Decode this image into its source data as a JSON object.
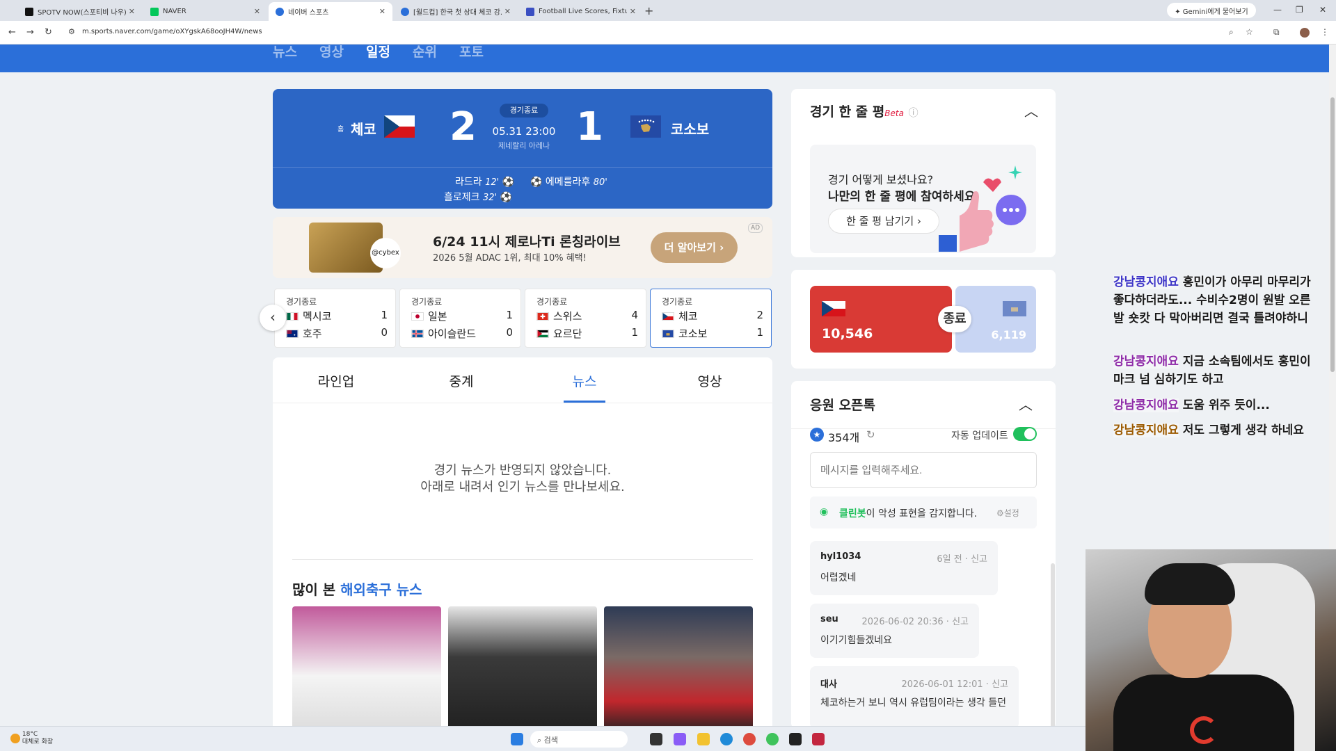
{
  "browser": {
    "tabs": [
      {
        "label": "SPOTV NOW(스포티비 나우)"
      },
      {
        "label": "NAVER"
      },
      {
        "label": "네이버 스포츠"
      },
      {
        "label": "[월드컵] 한국 첫 상대 체코 강..."
      },
      {
        "label": "Football Live Scores, Fixtures &..."
      }
    ],
    "gemini": "✦ Gemini에게 물어보기",
    "url": "m.sports.naver.com/game/oXYgskA68ooJH4W/news"
  },
  "nav": {
    "items": [
      "뉴스",
      "영상",
      "일정",
      "순위",
      "포토"
    ],
    "active": "일정"
  },
  "match": {
    "home_badge": "홈",
    "home": "체코",
    "away": "코소보",
    "home_score": "2",
    "away_score": "1",
    "status": "경기종료",
    "date": "05.31 23:00",
    "venue": "제네랄리 아레나",
    "goals_home": [
      {
        "player": "라드라",
        "minute": "12'"
      },
      {
        "player": "흘로제크",
        "minute": "32'"
      }
    ],
    "goals_away": [
      {
        "player": "에메를라후",
        "minute": "80'"
      }
    ],
    "colors": {
      "scoreboard": "#2c66c5",
      "accent": "#2b6fd9"
    }
  },
  "ad": {
    "title": "6/24 11시 제로나Ti 론칭라이브",
    "subtitle": "2026 5월 ADAC 1위, 최대 10% 혜택!",
    "button": "더 알아보기 ›",
    "tag": "AD",
    "logo": "@cybex"
  },
  "other_matches": [
    {
      "status": "경기종료",
      "home": "멕시코",
      "home_score": "1",
      "away": "호주",
      "away_score": "0"
    },
    {
      "status": "경기종료",
      "home": "일본",
      "home_score": "1",
      "away": "아이슬란드",
      "away_score": "0"
    },
    {
      "status": "경기종료",
      "home": "스위스",
      "home_score": "4",
      "away": "요르단",
      "away_score": "1"
    },
    {
      "status": "경기종료",
      "home": "체코",
      "home_score": "2",
      "away": "코소보",
      "away_score": "1"
    }
  ],
  "content_tabs": [
    "라인업",
    "중계",
    "뉴스",
    "영상"
  ],
  "content_active": "뉴스",
  "news_empty": {
    "line1": "경기 뉴스가 반영되지 않았습니다.",
    "line2": "아래로 내려서 인기 뉴스를 만나보세요."
  },
  "popular": {
    "prefix": "많이 본",
    "highlight": "해외축구 뉴스"
  },
  "one_line": {
    "title": "경기 한 줄 평",
    "beta": "Beta",
    "question": "경기 어떻게 보셨나요?",
    "invite": "나만의 한 줄 평에 참여하세요.",
    "button": "한 줄 평 남기기 ›"
  },
  "vote": {
    "home_count": "10,546",
    "away_count": "6,119",
    "status": "종료"
  },
  "talk": {
    "title": "응원 오픈톡",
    "count": "354개",
    "auto_update_label": "자동 업데이트",
    "auto_update_on": true,
    "input_placeholder": "메시지를 입력해주세요.",
    "cleanbot_name": "클린봇",
    "cleanbot_text": "이 악성 표현을 감지합니다.",
    "cleanbot_setting": "설정",
    "report": "신고",
    "messages": [
      {
        "user": "hyl1034",
        "time": "6일 전",
        "text": "어렵겠네"
      },
      {
        "user": "seu",
        "time": "2026-06-02 20:36",
        "text": "이기기힘들겠네요"
      },
      {
        "user": "대사",
        "time": "2026-06-01 12:01",
        "text": "체코하는거 보니 역시 유럽팀이라는 생각 들던"
      }
    ]
  },
  "stream_chat": [
    {
      "nick": "강남콩지애요",
      "text": "홍민이가 아무리 마무리가 좋다하더라도... 수비수2명이 원발 오른발 숏캇 다 막아버리면 결국 틀려야하니"
    },
    {
      "nick": "강남콩지애요",
      "text": "지금 소속팀에서도 홍민이 마크 넘 심하기도 하고"
    },
    {
      "nick": "강남콩지애요",
      "text": "도움 위주 듯이..."
    },
    {
      "nick": "강남콩지애요",
      "text": "저도 그렇게 생각 하네요"
    }
  ],
  "taskbar": {
    "temp": "18°C",
    "weather": "대체로 화창",
    "search": "검색"
  }
}
